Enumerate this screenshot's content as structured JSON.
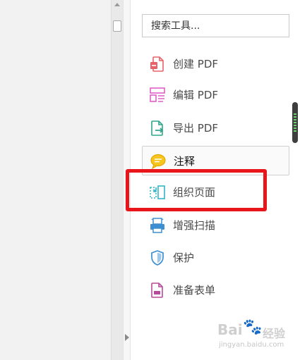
{
  "search": {
    "placeholder": "搜索工具..."
  },
  "tools": [
    {
      "label": "创建 PDF",
      "icon": "create-pdf-icon",
      "color": "#e8626b"
    },
    {
      "label": "编辑 PDF",
      "icon": "edit-pdf-icon",
      "color": "#e05fc9"
    },
    {
      "label": "导出 PDF",
      "icon": "export-pdf-icon",
      "color": "#2fa58a"
    },
    {
      "label": "注释",
      "icon": "comment-icon",
      "color": "#f2b300",
      "active": true
    },
    {
      "label": "组织页面",
      "icon": "organize-pages-icon",
      "color": "#32b5c7"
    },
    {
      "label": "增强扫描",
      "icon": "enhance-scans-icon",
      "color": "#3d8fd1"
    },
    {
      "label": "保护",
      "icon": "protect-icon",
      "color": "#3d8fd1"
    },
    {
      "label": "准备表单",
      "icon": "prepare-form-icon",
      "color": "#b84a9c"
    }
  ],
  "highlight_color": "#e8161b",
  "watermark": {
    "main": "Bai",
    "suffix": "经验",
    "sub": "jingyan.baidu.com"
  }
}
